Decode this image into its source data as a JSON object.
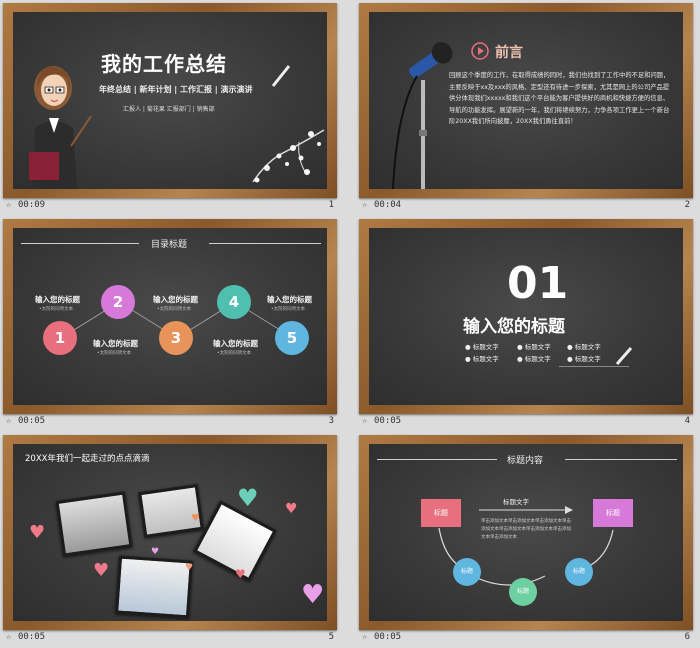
{
  "slides": [
    {
      "time": "00:09",
      "num": "1",
      "title": "我的工作总结",
      "subtitle": "年终总结 | 新年计划 | 工作汇报 | 演示演讲",
      "reporter": "汇报人 | 菊花果    汇报部门 | 销售部"
    },
    {
      "time": "00:04",
      "num": "2",
      "title": "前言",
      "body": "回顾这个季度的工作，在取得成绩的同时，我们也找到了工作中的不足和问题，主要反映于xx及xxx的风格、定型还有待进一步探索，尤其是网上的公司产品提供分体现我们xxxxx和我们这个平台能为客户提供好的商机和快捷方便的信息、导航的功能发挥。展望新的一年，我们将继续努力，力争各项工作更上一个新台阶20XX我们所向披靡，20XX我们勇往直前！"
    },
    {
      "time": "00:05",
      "num": "3",
      "heading": "目录标题",
      "items": [
        {
          "n": "1",
          "label": "输入您的标题",
          "sub": "•太院的同项文本"
        },
        {
          "n": "2",
          "label": "输入您的标题",
          "sub": "•太院的同项文本"
        },
        {
          "n": "3",
          "label": "输入您的标题",
          "sub": "•太院的同项文本"
        },
        {
          "n": "4",
          "label": "输入您的标题",
          "sub": "•太院的同项文本"
        },
        {
          "n": "5",
          "label": "输入您的标题",
          "sub": "•太院的同项文本"
        }
      ]
    },
    {
      "time": "00:05",
      "num": "4",
      "number": "01",
      "title": "输入您的标题",
      "bullets": [
        "● 标题文字",
        "● 标题文字",
        "● 标题文字",
        "● 标题文字",
        "● 标题文字",
        "● 标题文字"
      ]
    },
    {
      "time": "00:05",
      "num": "5",
      "title": "20XX年我们一起走过的点点滴滴"
    },
    {
      "time": "00:05",
      "num": "6",
      "heading": "标题内容",
      "box_left": "标题",
      "box_right": "标题",
      "arrow_label": "标题文字",
      "desc": "单击添加文本单击添加文本单击添加文本单击添加文本单击添加文本单击添加文本单击添加文本单击添加文本",
      "circles": [
        "标题",
        "标题",
        "标题"
      ]
    }
  ],
  "star_icon": "☆",
  "colors": {
    "pink": "#e8707e",
    "purple": "#d679d8",
    "orange": "#e8935a",
    "teal": "#4fc0b0",
    "blue": "#5fb6de",
    "green": "#6ecfa0"
  }
}
